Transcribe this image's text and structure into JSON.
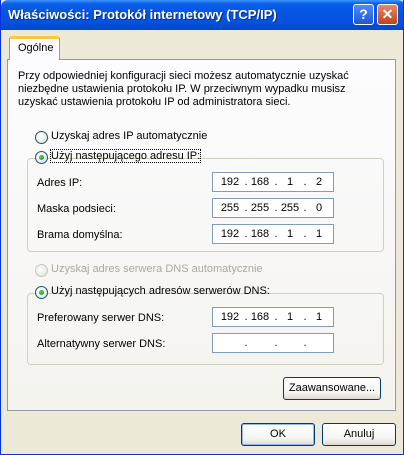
{
  "window": {
    "title": "Właściwości: Protokół internetowy (TCP/IP)",
    "help_glyph": "?",
    "close_glyph": "✕"
  },
  "tabs": [
    {
      "label": "Ogólne",
      "selected": true
    }
  ],
  "intro_text": [
    "Przy odpowiedniej konfiguracji sieci możesz automatycznie uzyskać",
    "niezbędne ustawienia protokołu IP. W przeciwnym wypadku musisz",
    "uzyskać ustawienia protokołu IP od administratora sieci."
  ],
  "ip_mode": {
    "auto_label": "Uzyskaj adres IP automatycznie",
    "manual_label": "Użyj następującego adresu IP:",
    "selected": "manual"
  },
  "ip_fields": [
    {
      "label": "Adres IP:",
      "octets": [
        "192",
        "168",
        "1",
        "2"
      ]
    },
    {
      "label": "Maska podsieci:",
      "octets": [
        "255",
        "255",
        "255",
        "0"
      ]
    },
    {
      "label": "Brama domyślna:",
      "octets": [
        "192",
        "168",
        "1",
        "1"
      ]
    }
  ],
  "dns_mode": {
    "auto_label": "Uzyskaj adres serwera DNS automatycznie",
    "manual_label": "Użyj następujących adresów serwerów DNS:",
    "selected": "manual"
  },
  "dns_fields": [
    {
      "label": "Preferowany serwer DNS:",
      "octets": [
        "192",
        "168",
        "1",
        "1"
      ]
    },
    {
      "label": "Alternatywny serwer DNS:",
      "octets": [
        "",
        "",
        "",
        ""
      ]
    }
  ],
  "ip_separator": ".",
  "buttons": {
    "advanced": "Zaawansowane...",
    "ok": "OK",
    "cancel": "Anuluj"
  },
  "colors": {
    "title_bar": "#0554e3",
    "window_bg": "#ece9d8",
    "close_button": "#c5401d",
    "tab_highlight": "#ffc83c",
    "radio_dot": "#1d8d18"
  }
}
